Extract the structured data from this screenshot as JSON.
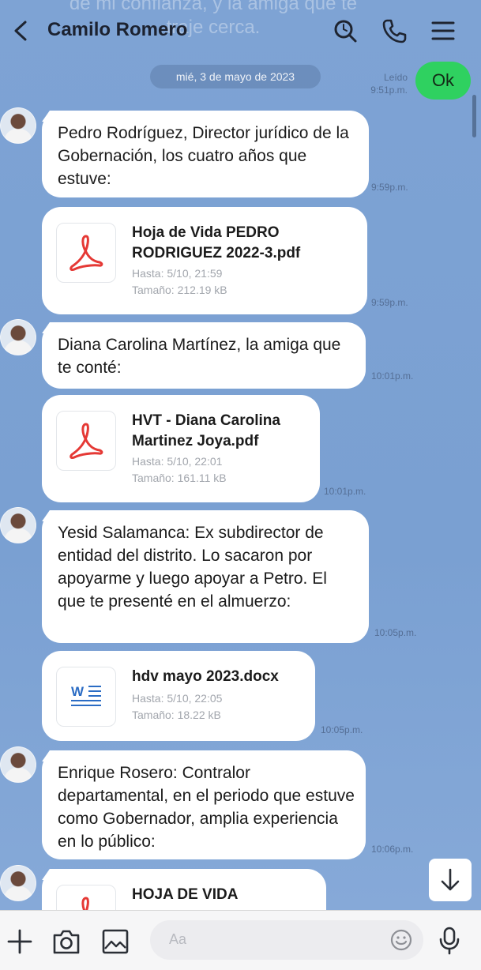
{
  "header": {
    "contact_name": "Camilo Romero",
    "ghost_text": "de mi confianza, y la amiga que te traje cerca."
  },
  "date_separator": "mié, 3 de mayo de 2023",
  "outgoing": {
    "text": "Ok",
    "read_label": "Leído",
    "time": "9:51p.m."
  },
  "messages": [
    {
      "type": "text",
      "text": "Pedro Rodríguez, Director jurídico de la Gobernación, los cuatro años que estuve:",
      "time": "9:59p.m."
    },
    {
      "type": "file",
      "file_type": "pdf",
      "name": "Hoja de Vida PEDRO RODRIGUEZ 2022-3.pdf",
      "expires": "Hasta: 5/10, 21:59",
      "size": "Tamaño: 212.19 kB",
      "time": "9:59p.m."
    },
    {
      "type": "text",
      "text": "Diana Carolina Martínez, la amiga que te conté:",
      "time": "10:01p.m."
    },
    {
      "type": "file",
      "file_type": "pdf",
      "name": "HVT - Diana Carolina Martinez Joya.pdf",
      "expires": "Hasta: 5/10, 22:01",
      "size": "Tamaño: 161.11 kB",
      "time": "10:01p.m."
    },
    {
      "type": "text",
      "text": "Yesid Salamanca: Ex subdirector de entidad del distrito. Lo sacaron por apoyarme y luego apoyar a Petro. El que te presenté en el almuerzo:",
      "time": "10:05p.m."
    },
    {
      "type": "file",
      "file_type": "docx",
      "name": "hdv mayo 2023.docx",
      "expires": "Hasta: 5/10, 22:05",
      "size": "Tamaño: 18.22 kB",
      "time": "10:05p.m."
    },
    {
      "type": "text",
      "text": "Enrique Rosero: Contralor departamental, en el periodo que estuve como Gobernador, amplia experiencia en lo público:",
      "time": "10:06p.m."
    },
    {
      "type": "file",
      "file_type": "pdf",
      "name": "HOJA DE VIDA"
    }
  ],
  "composer": {
    "placeholder": "Aa"
  },
  "colors": {
    "background": "#7da2d3",
    "outgoing_bubble": "#2fd160",
    "pdf_red": "#e53935",
    "word_blue": "#2b6cc4"
  }
}
